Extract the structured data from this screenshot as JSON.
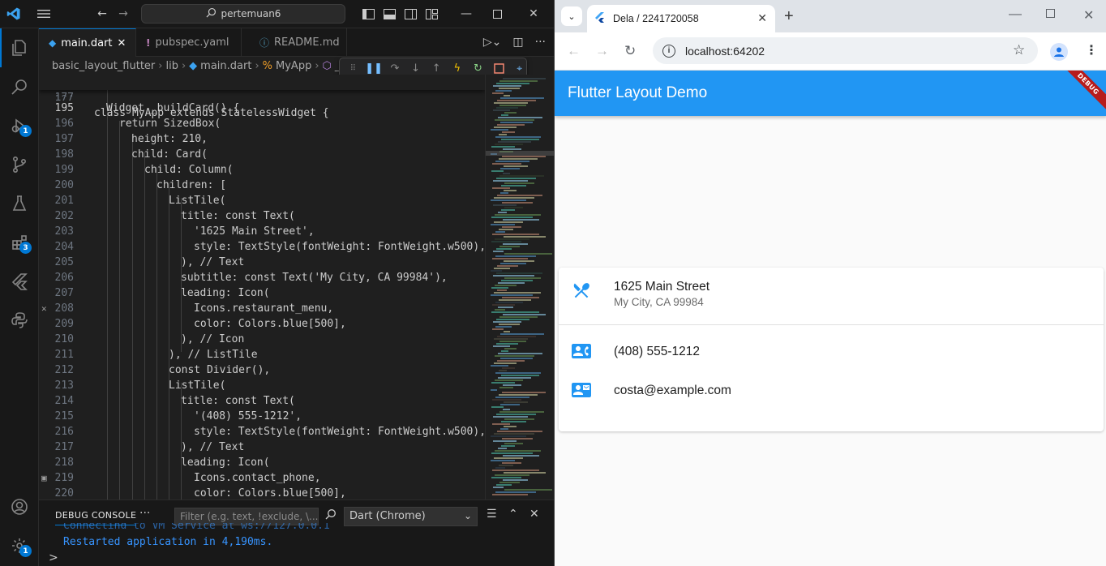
{
  "vscode": {
    "command_center": "pertemuan6",
    "tabs": [
      {
        "label": "main.dart",
        "icon": "dart-icon",
        "active": true
      },
      {
        "label": "pubspec.yaml",
        "icon": "exclamation-icon",
        "active": false
      },
      {
        "label": "README.md",
        "icon": "info-icon",
        "active": false
      }
    ],
    "breadcrumb": [
      "basic_layout_flutter",
      "lib",
      "main.dart",
      "MyApp",
      "_b"
    ],
    "activity_badges": {
      "run_debug": "1",
      "extensions": "3",
      "settings": "1"
    },
    "sticky_line": {
      "number": "177",
      "text": "class MyApp extends StatelessWidget {"
    },
    "partial_line": {
      "number": "194"
    },
    "code_lines": [
      {
        "number": "195",
        "text": "Widget _buildCard() {"
      },
      {
        "number": "196",
        "text": "return SizedBox("
      },
      {
        "number": "197",
        "text": "height: 210,"
      },
      {
        "number": "198",
        "text": "child: Card("
      },
      {
        "number": "199",
        "text": "child: Column("
      },
      {
        "number": "200",
        "text": "children: ["
      },
      {
        "number": "201",
        "text": "ListTile("
      },
      {
        "number": "202",
        "text": "title: const Text("
      },
      {
        "number": "203",
        "text": "'1625 Main Street',"
      },
      {
        "number": "204",
        "text": "style: TextStyle(fontWeight: FontWeight.w500),"
      },
      {
        "number": "205",
        "text": "), // Text"
      },
      {
        "number": "206",
        "text": "subtitle: const Text('My City, CA 99984'),"
      },
      {
        "number": "207",
        "text": "leading: Icon("
      },
      {
        "number": "208",
        "text": "Icons.restaurant_menu,"
      },
      {
        "number": "209",
        "text": "color: Colors.blue[500],"
      },
      {
        "number": "210",
        "text": "), // Icon"
      },
      {
        "number": "211",
        "text": "), // ListTile"
      },
      {
        "number": "212",
        "text": "const Divider(),"
      },
      {
        "number": "213",
        "text": "ListTile("
      },
      {
        "number": "214",
        "text": "title: const Text("
      },
      {
        "number": "215",
        "text": "'(408) 555-1212',"
      },
      {
        "number": "216",
        "text": "style: TextStyle(fontWeight: FontWeight.w500),"
      },
      {
        "number": "217",
        "text": "), // Text"
      },
      {
        "number": "218",
        "text": "leading: Icon("
      },
      {
        "number": "219",
        "text": "Icons.contact_phone,"
      },
      {
        "number": "220",
        "text": "color: Colors.blue[500],"
      }
    ],
    "panel": {
      "title": "DEBUG CONSOLE",
      "filter_placeholder": "Filter (e.g. text, !exclude, \\...",
      "select_value": "Dart (Chrome)",
      "output_line": "Restarted application in 4,190ms.",
      "prompt": ">"
    }
  },
  "chrome": {
    "tab_title": "Dela / 2241720058",
    "url": "localhost:64202",
    "app": {
      "title": "Flutter Layout Demo",
      "debug_banner": "DEBUG",
      "accent_color": "#2196f3",
      "tiles": [
        {
          "title": "1625 Main Street",
          "subtitle": "My City, CA 99984",
          "icon": "restaurant-menu-icon"
        },
        {
          "title": "(408) 555-1212",
          "icon": "contact-phone-icon"
        },
        {
          "title": "costa@example.com",
          "icon": "contact-mail-icon"
        }
      ]
    }
  }
}
